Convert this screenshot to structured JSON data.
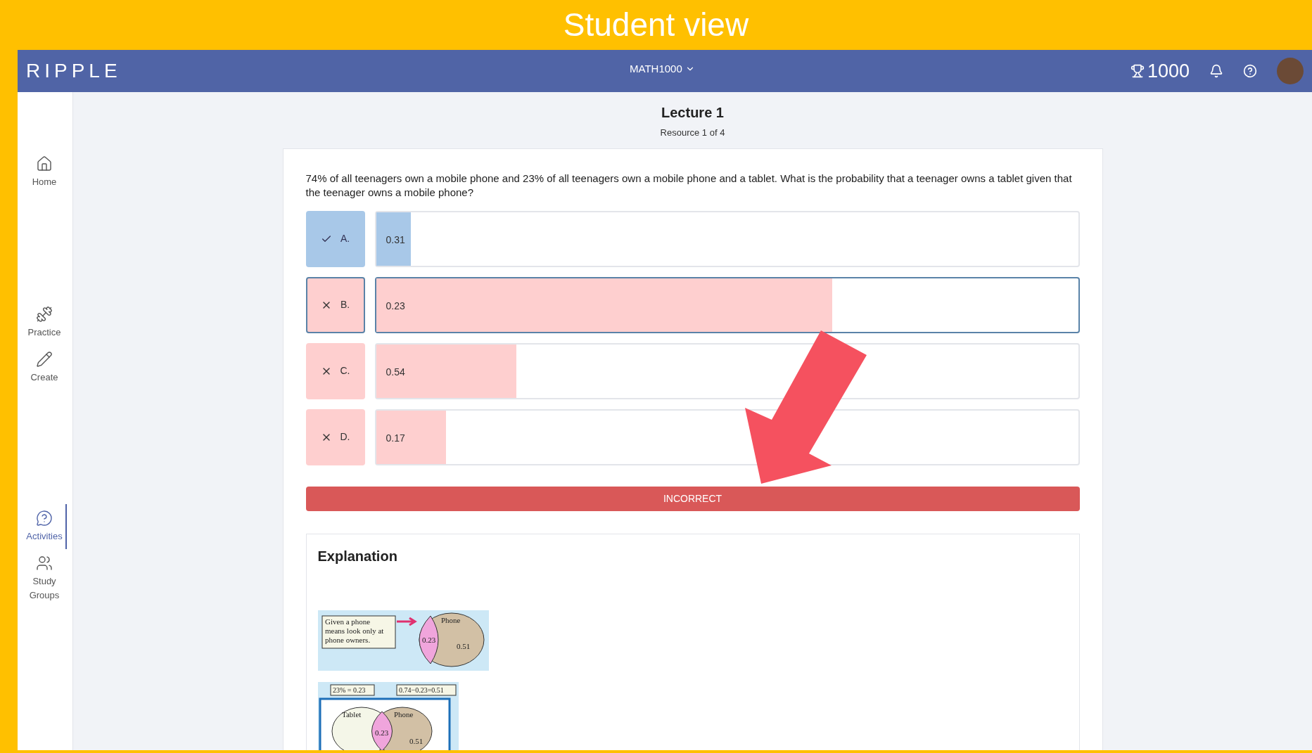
{
  "banner": {
    "title": "Student view"
  },
  "navbar": {
    "logo": "RIPPLE",
    "course": "MATH1000",
    "points": "1000"
  },
  "sidebar": {
    "items": [
      {
        "label": "Home",
        "kind": "home",
        "selected": false
      },
      {
        "label": "Practice",
        "kind": "practice",
        "selected": false
      },
      {
        "label": "Create",
        "kind": "create",
        "selected": false
      },
      {
        "label": "Activities",
        "kind": "activities",
        "selected": true
      },
      {
        "label": "Study Groups",
        "kind": "groups",
        "selected": false
      }
    ]
  },
  "header": {
    "title": "Lecture 1",
    "subtitle": "Resource 1 of 4"
  },
  "question": "74% of all teenagers own a mobile phone and 23% of all teenagers own a mobile phone and a tablet. What is the probability that a teenager owns a tablet given that the teenager owns a mobile phone?",
  "options": [
    {
      "letter": "A.",
      "value": "0.31",
      "kind": "correct",
      "selected": false,
      "level": 0.05
    },
    {
      "letter": "B.",
      "value": "0.23",
      "kind": "incorrect",
      "selected": true,
      "level": 0.65
    },
    {
      "letter": "C.",
      "value": "0.54",
      "kind": "incorrect",
      "selected": false,
      "level": 0.2
    },
    {
      "letter": "D.",
      "value": "0.17",
      "kind": "incorrect",
      "selected": false,
      "level": 0.1
    }
  ],
  "result": "INCORRECT",
  "explanation": {
    "title": "Explanation",
    "figure_1": {
      "note": [
        "Given a phone",
        "means look only at",
        "phone owners."
      ],
      "circle": "Phone",
      "overlap": "0.23",
      "rest": "0.51"
    },
    "figure_2": {
      "label_1": "23% = 0.23",
      "label_2": "0.74−0.23=0.51",
      "circle_1": "Tablet",
      "circle_2": "Phone",
      "overlap": "0.23",
      "rest": "0.51"
    }
  }
}
